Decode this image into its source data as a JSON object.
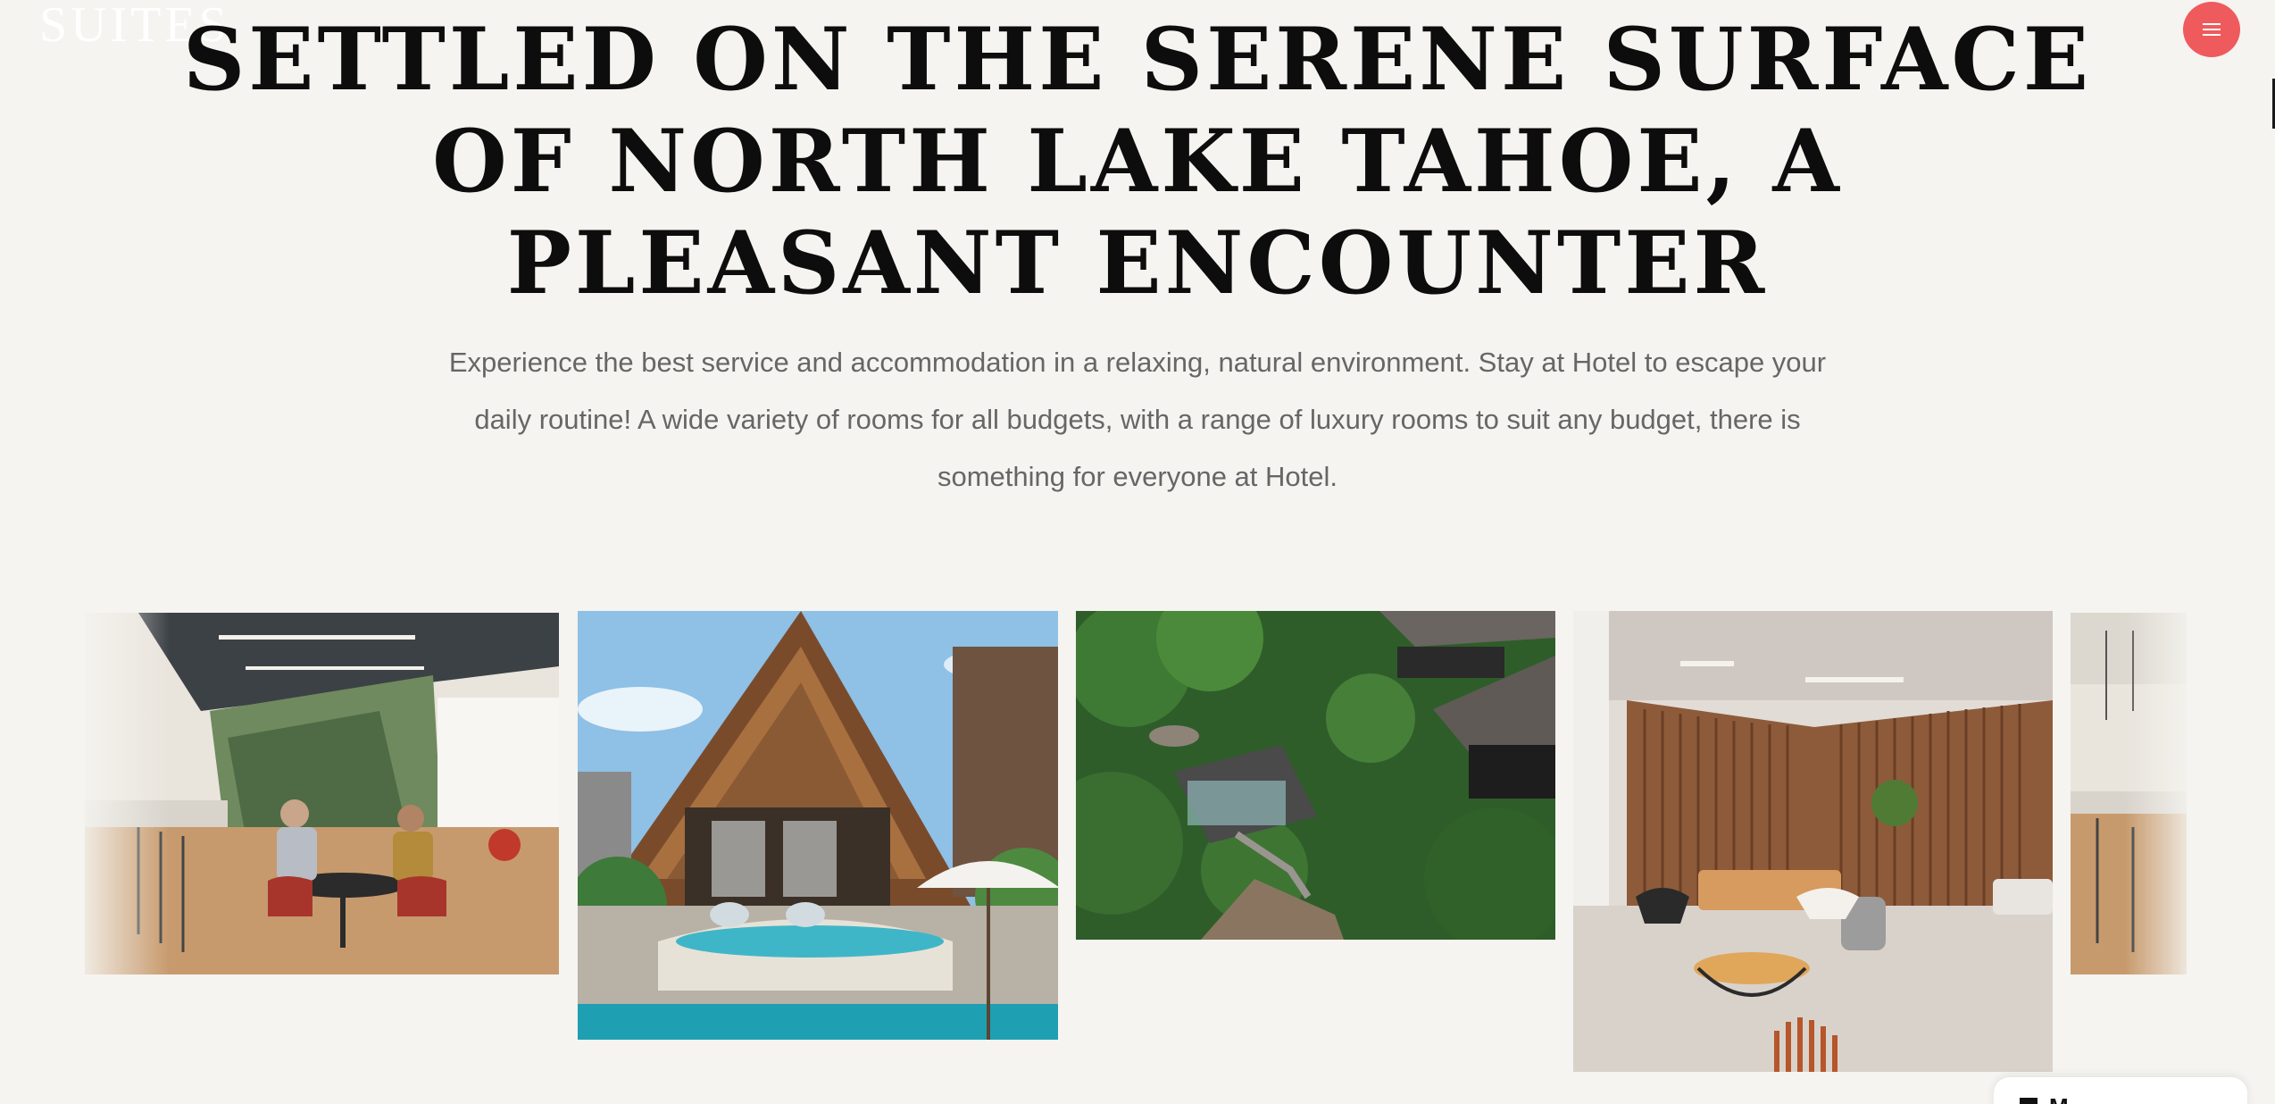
{
  "header": {
    "logo": "SUITES",
    "menu_icon": "hamburger-menu-icon",
    "menu_color": "#ef5a5c"
  },
  "hero": {
    "title": "SETTLED ON THE SERENE SURFACE OF NORTH LAKE TAHOE, A PLEASANT ENCOUNTER",
    "description": "Experience the best service and accommodation in a relaxing, natural environment. Stay at Hotel to escape your daily routine! A wide variety of rooms for all budgets, with a range of luxury rooms to suit any budget, there is something for everyone at Hotel."
  },
  "gallery": {
    "photos": [
      {
        "subject": "coworking-lounge-photo"
      },
      {
        "subject": "villa-pool-photo"
      },
      {
        "subject": "jungle-resort-aerial-photo"
      },
      {
        "subject": "hotel-lobby-lounge-photo"
      },
      {
        "subject": "coworking-lounge-photo-repeat"
      }
    ]
  },
  "chat_widget": {
    "label": "M...",
    "icon": "chat-bubble-icon"
  },
  "colors": {
    "background": "#f5f4f0",
    "heading": "#0d0d0d",
    "body_text": "#666666",
    "accent": "#ef5a5c"
  }
}
